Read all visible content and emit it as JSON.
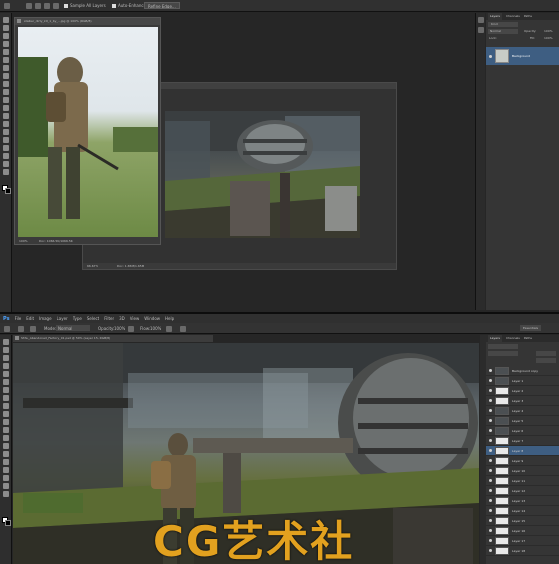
{
  "top": {
    "options": [
      "Sample All Layers",
      "Auto-Enhance",
      "Refine Edge..."
    ],
    "doc_small": {
      "title": "stalker_dirty_kit_1_by_...jpg @ 100% (RGB/8)",
      "zoom": "100%",
      "doc_info": "Doc: 1066.5K/1066.5K"
    },
    "doc_large": {
      "zoom": "66.67%",
      "doc_info": "Doc: 1.65M/1.65M"
    },
    "panel_tabs": [
      "Layers",
      "Channels",
      "Paths"
    ],
    "kind_label": "Kind",
    "mode_label": "Normal",
    "opacity_label": "Opacity:",
    "opacity_value": "100%",
    "lock_label": "Lock:",
    "fill_label": "Fill:",
    "fill_value": "100%",
    "layer_name": "Background"
  },
  "bottom": {
    "menu": [
      "Ps",
      "File",
      "Edit",
      "Image",
      "Layer",
      "Type",
      "Select",
      "Filter",
      "3D",
      "View",
      "Window",
      "Help"
    ],
    "workspace": "Essentials",
    "options": {
      "mode_label": "Mode:",
      "mode_value": "Normal",
      "opacity_label": "Opacity:",
      "opacity_value": "100%",
      "flow_label": "Flow:",
      "flow_value": "100%"
    },
    "doc_title": "STAL_Abandoned_Factory_01.psd @ 50% (Layer 15, RGB/8)",
    "panel_tabs": [
      "Layers",
      "Channels",
      "Paths"
    ],
    "layers": [
      "Background copy",
      "Layer 1",
      "Layer 2",
      "Layer 3",
      "Layer 4",
      "Layer 5",
      "Layer 6",
      "Layer 7",
      "Layer 8",
      "Layer 9",
      "Layer 10",
      "Layer 11",
      "Layer 12",
      "Layer 13",
      "Layer 14",
      "Layer 15",
      "Layer 16",
      "Layer 17",
      "Layer 18"
    ],
    "watermark": "CG艺术社"
  },
  "colors": {
    "accent": "#2d6aa3",
    "watermark": "#e2a11f",
    "selected_layer": "#3e5e82"
  }
}
